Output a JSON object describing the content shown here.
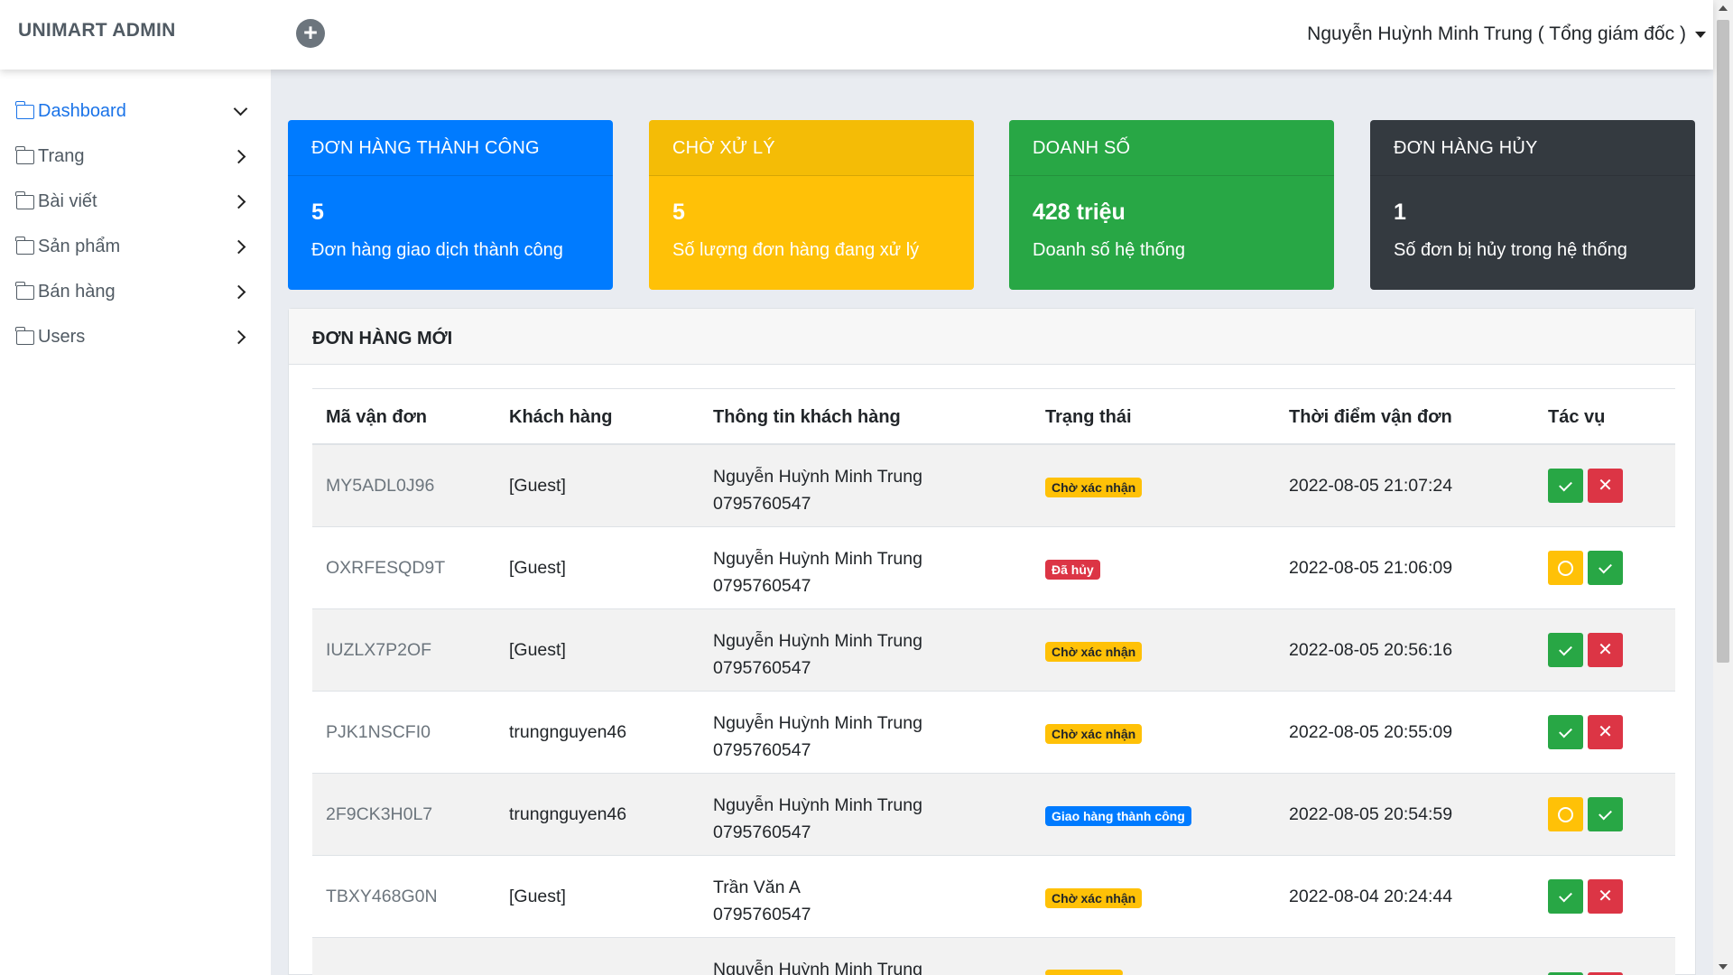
{
  "header": {
    "brand": "UNIMART ADMIN",
    "add_icon": "plus-circle-icon",
    "user": "Nguyễn Huỳnh Minh Trung ( Tổng giám đốc )"
  },
  "sidebar": {
    "items": [
      {
        "label": "Dashboard",
        "active": true,
        "expanded": true
      },
      {
        "label": "Trang"
      },
      {
        "label": "Bài viết"
      },
      {
        "label": "Sản phẩm"
      },
      {
        "label": "Bán hàng"
      },
      {
        "label": "Users"
      }
    ]
  },
  "cards": [
    {
      "title": "ĐƠN HÀNG THÀNH CÔNG",
      "value": "5",
      "desc": "Đơn hàng giao dịch thành công",
      "color": "#007bff"
    },
    {
      "title": "CHỜ XỬ LÝ",
      "value": "5",
      "desc": "Số lượng đơn hàng đang xử lý",
      "color": "#ffc107"
    },
    {
      "title": "DOANH SỐ",
      "value": "428 triệu",
      "desc": "Doanh số hệ thống",
      "color": "#28a745"
    },
    {
      "title": "ĐƠN HÀNG HỦY",
      "value": "1",
      "desc": "Số đơn bị hủy trong hệ thống",
      "color": "#343a40"
    }
  ],
  "orders": {
    "title": "ĐƠN HÀNG MỚI",
    "columns": [
      "Mã vận đơn",
      "Khách hàng",
      "Thông tin khách hàng",
      "Trạng thái",
      "Thời điểm vận đơn",
      "Tác vụ"
    ],
    "rows": [
      {
        "code": "MY5ADL0J96",
        "customer": "[Guest]",
        "name": "Nguyễn Huỳnh Minh Trung",
        "phone": "0795760547",
        "status": "Chờ xác nhận",
        "time": "2022-08-05 21:07:24"
      },
      {
        "code": "OXRFESQD9T",
        "customer": "[Guest]",
        "name": "Nguyễn Huỳnh Minh Trung",
        "phone": "0795760547",
        "status": "Đã hủy",
        "time": "2022-08-05 21:06:09"
      },
      {
        "code": "IUZLX7P2OF",
        "customer": "[Guest]",
        "name": "Nguyễn Huỳnh Minh Trung",
        "phone": "0795760547",
        "status": "Chờ xác nhận",
        "time": "2022-08-05 20:56:16"
      },
      {
        "code": "PJK1NSCFI0",
        "customer": "trungnguyen46",
        "name": "Nguyễn Huỳnh Minh Trung",
        "phone": "0795760547",
        "status": "Chờ xác nhận",
        "time": "2022-08-05 20:55:09"
      },
      {
        "code": "2F9CK3H0L7",
        "customer": "trungnguyen46",
        "name": "Nguyễn Huỳnh Minh Trung",
        "phone": "0795760547",
        "status": "Giao hàng thành công",
        "time": "2022-08-05 20:54:59"
      },
      {
        "code": "TBXY468G0N",
        "customer": "[Guest]",
        "name": "Trần Văn A",
        "phone": "0795760547",
        "status": "Chờ xác nhận",
        "time": "2022-08-04 20:24:44"
      },
      {
        "code": "",
        "customer": "",
        "name": "Nguyễn Huỳnh Minh Trung",
        "phone": "",
        "status": "",
        "time": ""
      }
    ]
  }
}
